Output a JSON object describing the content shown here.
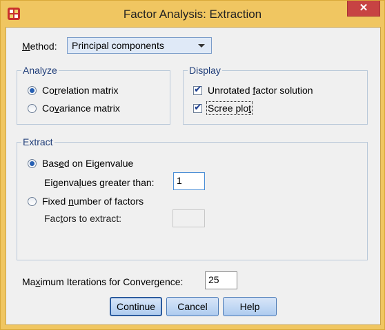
{
  "window": {
    "title": "Factor Analysis: Extraction",
    "close_glyph": "✕",
    "app_icon": "spss-app-icon"
  },
  "method": {
    "label_u": "M",
    "label_rest": "ethod:",
    "selected": "Principal components"
  },
  "analyze": {
    "legend": "Analyze",
    "correlation": {
      "pre": "Co",
      "u": "r",
      "post": "relation matrix",
      "selected": true
    },
    "covariance": {
      "pre": "Co",
      "u": "v",
      "post": "ariance matrix",
      "selected": false
    }
  },
  "display": {
    "legend": "Display",
    "unrotated": {
      "pre": "Unrotated ",
      "u": "f",
      "post": "actor solution",
      "checked": true
    },
    "scree": {
      "pre": "Scree plo",
      "u": "t",
      "post": "",
      "checked": true
    }
  },
  "extract": {
    "legend": "Extract",
    "eigen_option": {
      "pre": "Bas",
      "u": "e",
      "post": "d on Eigenvalue",
      "selected": true
    },
    "eigen_threshold": {
      "pre": "Eigenva",
      "u": "l",
      "post": "ues greater than:",
      "value": "1"
    },
    "fixed_option": {
      "pre": "Fixed ",
      "u": "n",
      "post": "umber of factors",
      "selected": false
    },
    "factors_to_extract": {
      "pre": "Fac",
      "u": "t",
      "post": "ors to extract:",
      "value": ""
    }
  },
  "iterations": {
    "pre": "Ma",
    "u": "x",
    "post": "imum Iterations for Convergence:",
    "value": "25"
  },
  "buttons": {
    "continue": "Continue",
    "cancel": "Cancel",
    "help": "Help"
  },
  "colors": {
    "title_bar": "#f0c661",
    "accent": "#2760b3",
    "group_legend": "#1e3c78",
    "close_button": "#c74343"
  }
}
